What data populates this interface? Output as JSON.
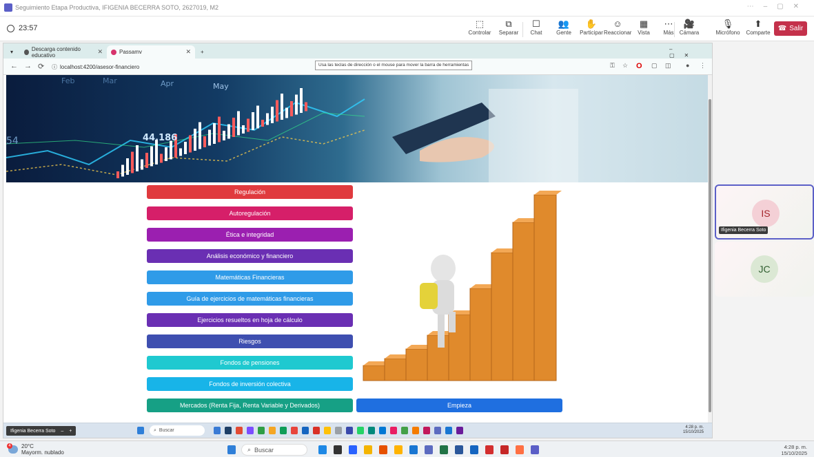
{
  "teams": {
    "title": "Seguimiento Etapa Productiva, IFIGENIA BECERRA SOTO, 2627019, M2",
    "timer": "23:57",
    "tools": [
      {
        "label": "Controlar",
        "icon": "control-icon",
        "glyph": "⬚"
      },
      {
        "label": "Separar",
        "icon": "popout-icon",
        "glyph": "⧉"
      },
      {
        "label": "Chat",
        "icon": "chat-icon",
        "glyph": "☐"
      },
      {
        "label": "Gente",
        "icon": "people-icon",
        "glyph": "👥"
      },
      {
        "label": "Participar",
        "icon": "raise-hand-icon",
        "glyph": "✋"
      },
      {
        "label": "Reaccionar",
        "icon": "smile-icon",
        "glyph": "☺"
      },
      {
        "label": "Vista",
        "icon": "grid-icon",
        "glyph": "▦"
      },
      {
        "label": "Más",
        "icon": "more-icon",
        "glyph": "⋯"
      },
      {
        "label": "Cámara",
        "icon": "camera-icon",
        "glyph": "🎥"
      },
      {
        "label": "Micrófono",
        "icon": "mic-icon",
        "glyph": "🎙"
      },
      {
        "label": "Comparte",
        "icon": "share-icon",
        "glyph": "⬆"
      }
    ],
    "people_count": "2",
    "leave_label": "Salir"
  },
  "browser": {
    "tabs": [
      {
        "label": "Descarga contenido educativo",
        "color": "#555"
      },
      {
        "label": "Passamv",
        "color": "#d6336c"
      }
    ],
    "url": "localhost:4200/asesor-financiero",
    "tooltip": "Usa las teclas de dirección o el mouse para mover la barra de herramientas"
  },
  "banner": {
    "numbers": [
      "44.186",
      "54"
    ],
    "months": [
      "Feb",
      "Mar",
      "Apr",
      "May"
    ]
  },
  "menu": [
    {
      "label": "Regulación",
      "color": "#e03a3e"
    },
    {
      "label": "Autoregulación",
      "color": "#d61f69"
    },
    {
      "label": "Ética e integridad",
      "color": "#9b1fb0"
    },
    {
      "label": "Análisis económico y financiero",
      "color": "#6a2fb3"
    },
    {
      "label": "Matemáticas Financieras",
      "color": "#2f9be8"
    },
    {
      "label": "Guía de ejercicios de matemáticas financieras",
      "color": "#2f9be8"
    },
    {
      "label": "Ejercicios resueltos en hoja de cálculo",
      "color": "#6a2fb3"
    },
    {
      "label": "Riesgos",
      "color": "#3e4fb0"
    },
    {
      "label": "Fondos de pensiones",
      "color": "#1fc9d0"
    },
    {
      "label": "Fondos de inversión colectiva",
      "color": "#18b4e8"
    },
    {
      "label": "Mercados (Renta Fija, Renta Variable y Derivados)",
      "color": "#16a085"
    }
  ],
  "start_label": "Empieza",
  "inner_taskbar": {
    "presenter": "Ifigenia Becerra Soto",
    "search": "Buscar",
    "time": "4:28 p. m.",
    "date": "15/10/2025"
  },
  "participants": [
    {
      "initials": "IS",
      "name": "Ifigenia Becerra Soto",
      "color": "#f4d0d6",
      "text": "#a4262c"
    },
    {
      "initials": "JC",
      "name": "",
      "color": "#dbe8d4",
      "text": "#2f5d2f"
    }
  ],
  "windows": {
    "temp": "20°C",
    "weather": "Mayorm. nublado",
    "alert_count": "4",
    "search": "Buscar",
    "time": "4:28 p. m.",
    "date": "15/10/2025"
  }
}
